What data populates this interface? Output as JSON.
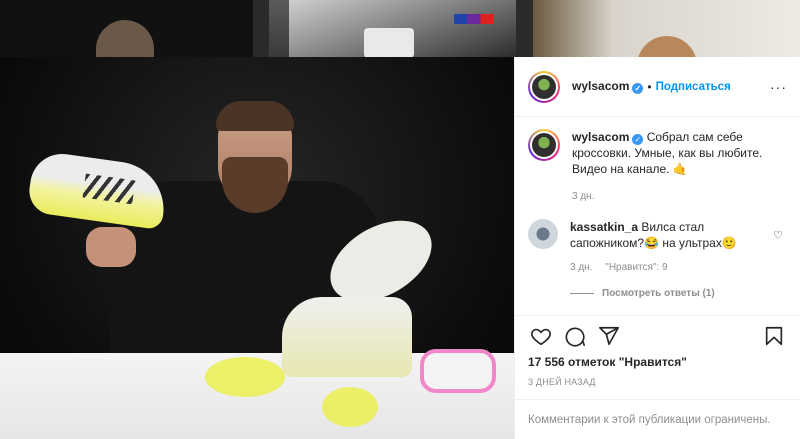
{
  "post": {
    "username": "wylsacom",
    "follow_label": "Подписаться",
    "dot": "•",
    "more_label": "···"
  },
  "caption": {
    "username": "wylsacom",
    "text": "Собрал сам себе кроссовки. Умные, как вы любите. Видео на канале. 🤙",
    "time": "3 дн."
  },
  "comment": {
    "username": "kassatkin_a",
    "text": "Вилса стал сапожником?😂 на ультрах🙂",
    "time": "3 дн.",
    "likes": "\"Нравится\": 9",
    "view_replies": "Посмотреть ответы (1)"
  },
  "likes": "17 556 отметок \"Нравится\"",
  "date": "3 ДНЕЙ НАЗАД",
  "comments_limited": "Комментарии к этой публикации ограничены.",
  "icons": {
    "verified": "verified-icon",
    "like": "heart-icon",
    "comment": "comment-icon",
    "share": "share-icon",
    "save": "bookmark-icon"
  },
  "colors": {
    "accent": "#0095f6",
    "verified": "#3897f0",
    "text": "#262626",
    "muted": "#8e8e8e"
  }
}
